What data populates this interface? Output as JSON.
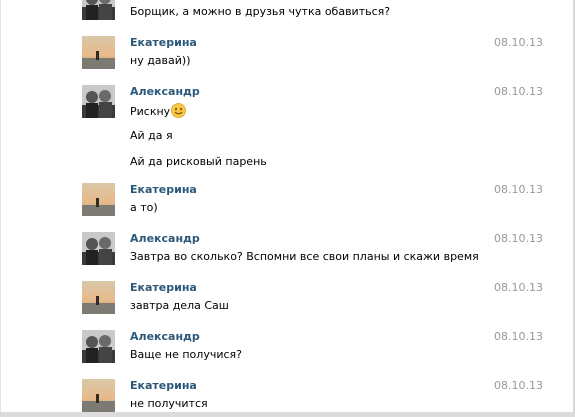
{
  "messages": [
    {
      "author": "",
      "date": "",
      "lines": [
        "Борщик, а можно в друзья чутка обавиться?"
      ],
      "avatar": "alexandr-avatar"
    },
    {
      "author": "Екатерина",
      "date": "08.10.13",
      "lines": [
        "ну давай))"
      ],
      "avatar": "ekaterina-avatar"
    },
    {
      "author": "Александр",
      "date": "08.10.13",
      "lines": [
        "Рискну",
        "Ай да я",
        "Ай да рисковый парень"
      ],
      "avatar": "alexandr-avatar",
      "emoji": "smile-emoji"
    },
    {
      "author": "Екатерина",
      "date": "08.10.13",
      "lines": [
        "а то)"
      ],
      "avatar": "ekaterina-avatar"
    },
    {
      "author": "Александр",
      "date": "08.10.13",
      "lines": [
        "Завтра во сколько? Вспомни все свои планы и скажи время"
      ],
      "avatar": "alexandr-avatar"
    },
    {
      "author": "Екатерина",
      "date": "08.10.13",
      "lines": [
        "завтра дела Саш"
      ],
      "avatar": "ekaterina-avatar"
    },
    {
      "author": "Александр",
      "date": "08.10.13",
      "lines": [
        "Ваще не получися?"
      ],
      "avatar": "alexandr-avatar"
    },
    {
      "author": "Екатерина",
      "date": "08.10.13",
      "lines": [
        "не получится"
      ],
      "avatar": "ekaterina-avatar"
    }
  ],
  "colors": {
    "author": "#2b587a",
    "date": "#999999",
    "text": "#000000"
  }
}
